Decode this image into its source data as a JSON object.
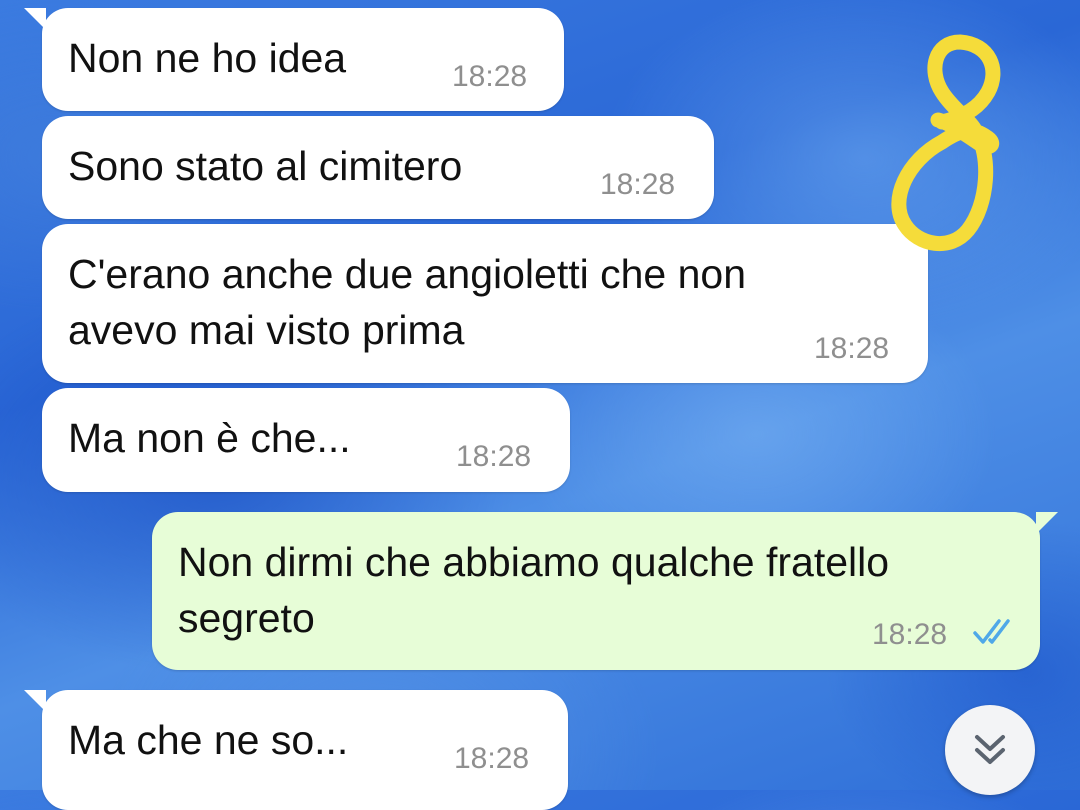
{
  "messages": [
    {
      "text": "Non ne ho idea",
      "time": "18:28",
      "direction": "incoming"
    },
    {
      "text": "Sono stato al cimitero",
      "time": "18:28",
      "direction": "incoming"
    },
    {
      "line1": "C'erano anche due angioletti che non",
      "line2": "avevo mai visto prima",
      "time": "18:28",
      "direction": "incoming"
    },
    {
      "text": "Ma non è che...",
      "time": "18:28",
      "direction": "incoming"
    },
    {
      "line1": "Non dirmi che abbiamo qualche fratello",
      "line2": "segreto",
      "time": "18:28",
      "direction": "outgoing",
      "status": "read"
    },
    {
      "text": "Ma che ne so...",
      "time": "18:28",
      "direction": "incoming"
    }
  ],
  "colors": {
    "incoming_bubble": "#ffffff",
    "outgoing_bubble": "#e7fdd7",
    "read_ticks": "#4fa8e8",
    "doodle": "#f5dc3a",
    "wallpaper": "#2f6fd8"
  },
  "icons": {
    "read_receipt": "double-check-icon",
    "scroll_down": "double-chevron-down-icon",
    "drawing": "yellow-loop-doodle"
  }
}
